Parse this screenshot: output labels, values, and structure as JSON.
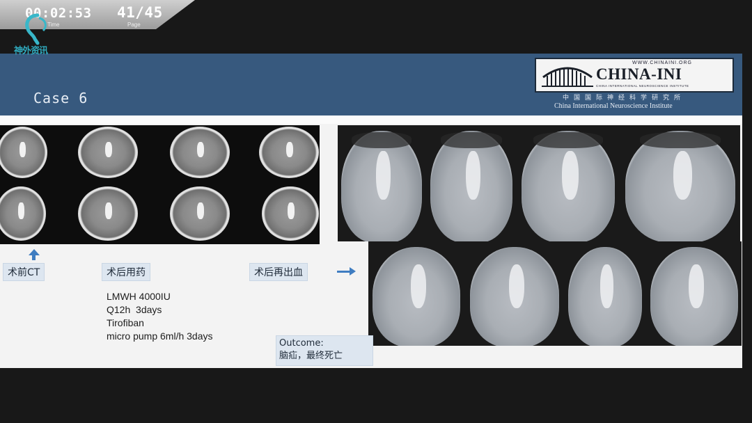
{
  "player": {
    "time_value": "00:02:53",
    "time_label": "Time",
    "page_value": "41/45",
    "page_label": "Page"
  },
  "channel_logo": {
    "text": "神外资讯",
    "icon": "neurosurgery-logo-icon"
  },
  "slide": {
    "title": "Case 6",
    "brand": {
      "url": "WWW.CHINAINI.ORG",
      "name": "CHINA-INI",
      "subtitle": "CHINA INTERNATIONAL NEUROSCIENCE INSTITUTE",
      "cn_name": "中国国际神经科学研究所",
      "en_name": "China International Neuroscience Institute"
    },
    "labels": {
      "preop_ct": "术前CT",
      "postop_med": "术后用药",
      "postop_rebleed": "术后再出血"
    },
    "medication": [
      "LMWH 4000IU",
      "Q12h  3days",
      "Tirofiban",
      "micro pump 6ml/h 3days"
    ],
    "outcome": {
      "title": "Outcome:",
      "text": "脑疝，最终死亡"
    }
  },
  "colors": {
    "header": "#37597e",
    "accent_arrow": "#3f7dc1",
    "label_bg": "#dde6f0"
  }
}
